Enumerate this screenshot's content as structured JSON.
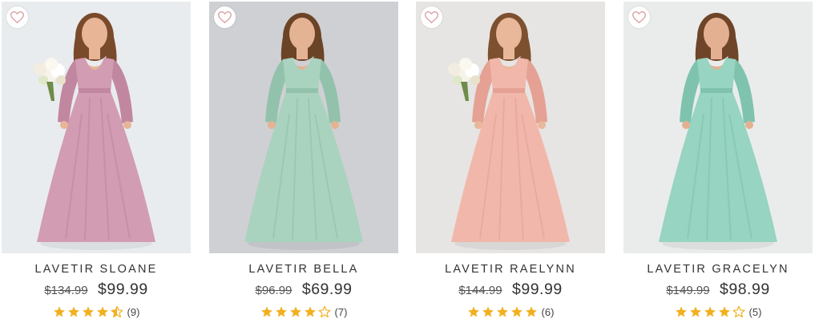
{
  "colors": {
    "star": "#f2b01e",
    "heart_stroke": "#d79a9a"
  },
  "products": [
    {
      "name": "LAVETIR SLOANE",
      "old_price": "$134.99",
      "price": "$99.99",
      "rating": 4.5,
      "review_count": "(9)",
      "photo": {
        "bg": "#e9ecee",
        "dress": "#d29cb2",
        "dress_dark": "#c287a0",
        "skin": "#e8b697",
        "hair": "#7a4a2c",
        "bouquet": true
      }
    },
    {
      "name": "LAVETIR BELLA",
      "old_price": "$96.99",
      "price": "$69.99",
      "rating": 4,
      "review_count": "(7)",
      "photo": {
        "bg": "#cfd0d4",
        "dress": "#a9d3bf",
        "dress_dark": "#92c2ac",
        "skin": "#e4b394",
        "hair": "#6b4326",
        "bouquet": false
      }
    },
    {
      "name": "LAVETIR RAELYNN",
      "old_price": "$144.99",
      "price": "$99.99",
      "rating": 5,
      "review_count": "(6)",
      "photo": {
        "bg": "#e6e5e3",
        "dress": "#f2b7ab",
        "dress_dark": "#e5a194",
        "skin": "#e9b89a",
        "hair": "#7d5030",
        "bouquet": true
      }
    },
    {
      "name": "LAVETIR GRACELYN",
      "old_price": "$149.99",
      "price": "$98.99",
      "rating": 4,
      "review_count": "(5)",
      "photo": {
        "bg": "#eaecec",
        "dress": "#97d4c2",
        "dress_dark": "#7fc3af",
        "skin": "#e3b192",
        "hair": "#6e4528",
        "bouquet": false
      }
    }
  ]
}
